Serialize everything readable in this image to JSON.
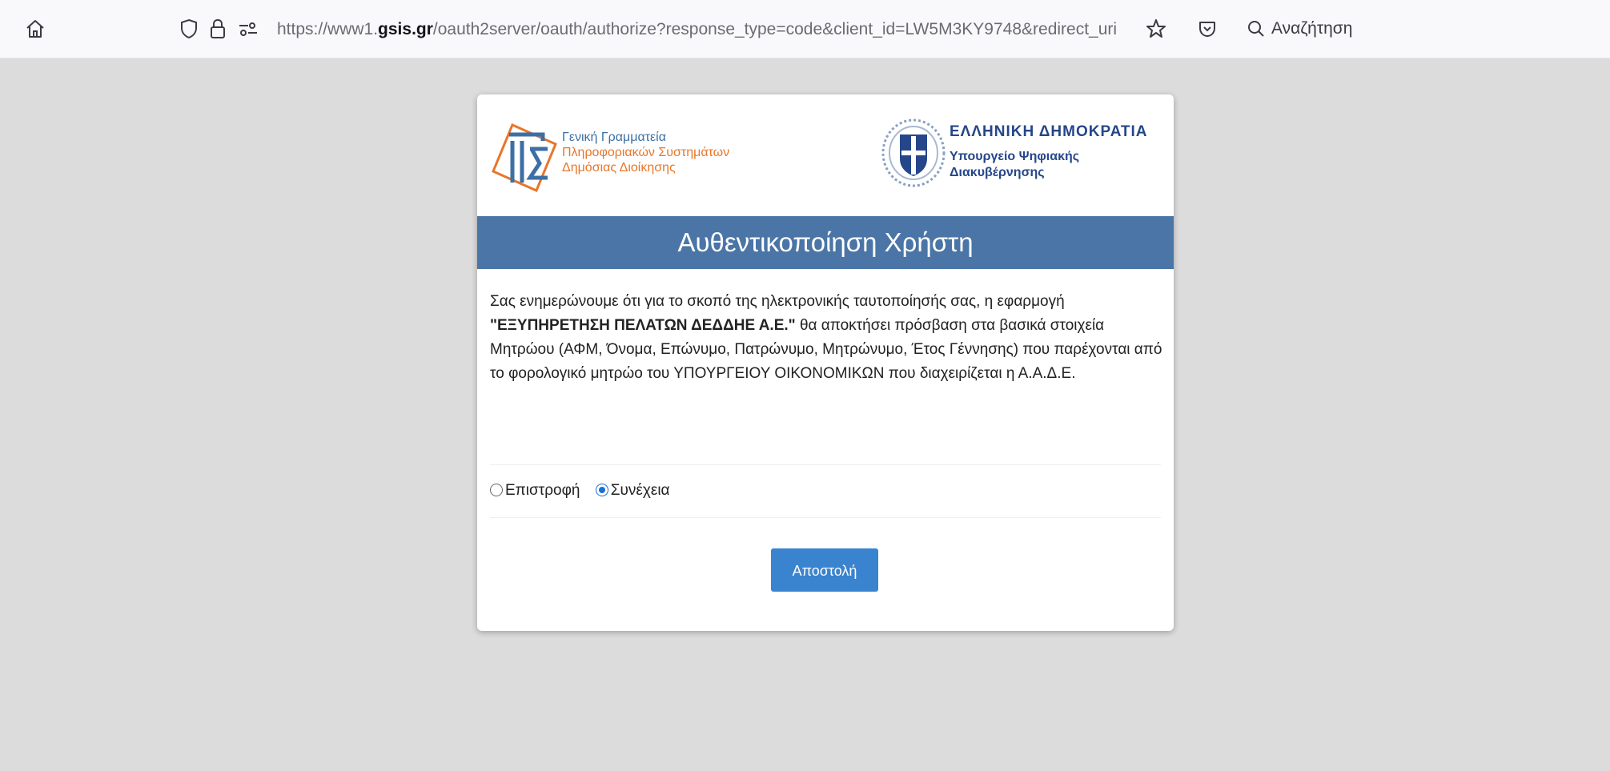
{
  "browser": {
    "url_prefix": "https://www1.",
    "url_domain": "gsis.gr",
    "url_rest": "/oauth2server/oauth/authorize?response_type=code&client_id=LW5M3KY9748&redirect_uri",
    "search_placeholder": "Αναζήτηση"
  },
  "logos": {
    "left": {
      "line1": "Γενική Γραμματεία",
      "line2": "Πληροφοριακών Συστημάτων",
      "line3": "Δημόσιας Διοίκησης"
    },
    "right": {
      "title": "ΕΛΛΗΝΙΚΗ ΔΗΜΟΚΡΑΤΙΑ",
      "line1": "Υπουργείο Ψηφιακής",
      "line2": "Διακυβέρνησης"
    }
  },
  "dialog": {
    "title": "Αυθεντικοποίηση Χρήστη",
    "text_before": "Σας ενημερώνουμε ότι για το σκοπό της ηλεκτρονικής ταυτοποίησής σας, η εφαρμογή ",
    "app_name": "\"ΕΞΥΠΗΡΕΤΗΣΗ ΠΕΛΑΤΩΝ ΔΕΔΔΗΕ Α.Ε.\"",
    "text_after": " θα αποκτήσει πρόσβαση στα βασικά στοιχεία Μητρώου (ΑΦΜ, Όνομα, Επώνυμο, Πατρώνυμο, Μητρώνυμο, Έτος Γέννησης) που παρέχονται από το φορολογικό μητρώο του ΥΠΟΥΡΓΕΙΟΥ ΟΙΚΟΝΟΜΙΚΩΝ που διαχειρίζεται η Α.Α.Δ.Ε.",
    "radio_back": "Επιστροφή",
    "radio_continue": "Συνέχεια",
    "selected": "Συνέχεια",
    "submit_label": "Αποστολή"
  },
  "colors": {
    "banner": "#4a75a6",
    "button": "#3a83cf",
    "background": "#dcdcdc"
  }
}
